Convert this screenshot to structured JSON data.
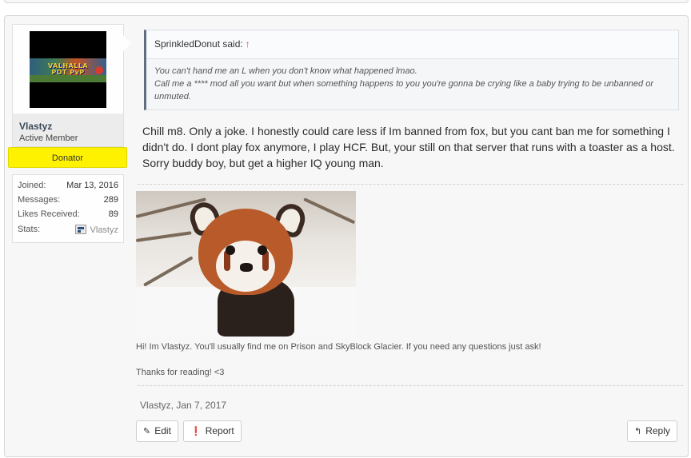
{
  "user": {
    "name": "Vlastyz",
    "title": "Active Member",
    "banner": "Donator",
    "avatar_text": "VALHALLA POT PvP",
    "stats": {
      "joined_label": "Joined:",
      "joined": "Mar 13, 2016",
      "messages_label": "Messages:",
      "messages": "289",
      "likes_label": "Likes Received:",
      "likes": "89",
      "stats_label": "Stats:",
      "stats_link": "Vlastyz"
    }
  },
  "quote": {
    "author": "SprinkledDonut said:",
    "arrow_icon": "up-arrow",
    "lines": [
      "You can't hand me an L when you don't know what happened lmao.",
      "Call me a **** mod all you want but when something happens to you you're gonna be crying like a baby trying to be unbanned or unmuted."
    ]
  },
  "message": "Chill m8. Only a joke. I honestly could care less if Im banned from fox, but you cant ban me for something I didn't do. I dont play fox anymore, I play HCF. But, your still on that server that runs with a toaster as a host. Sorry buddy boy, but get a higher IQ young man.",
  "signature": {
    "line1": "Hi! Im Vlastyz. You'll usually find me on Prison and SkyBlock Glacier. If you need any questions just ask!",
    "line2": "Thanks for reading! <3"
  },
  "meta": "Vlastyz, Jan 7, 2017",
  "actions": {
    "edit": "Edit",
    "report": "Report",
    "reply": "Reply"
  },
  "colors": {
    "donator": "#fff200",
    "quote_arrow": "#e04f3a",
    "quote_border": "#5f6f7f"
  }
}
